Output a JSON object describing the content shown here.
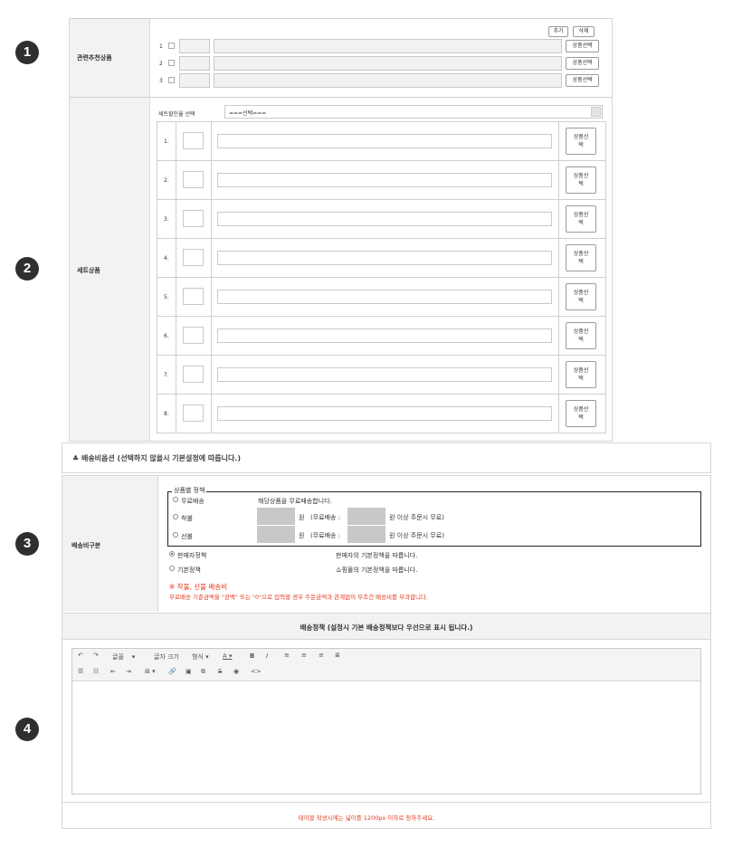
{
  "markers": [
    "1",
    "2",
    "3",
    "4"
  ],
  "related": {
    "label": "관련추천상품",
    "add_label": "추가",
    "delete_label": "삭제",
    "rows": [
      {
        "num": "1",
        "select_label": "상품선택"
      },
      {
        "num": "2",
        "select_label": "상품선택"
      },
      {
        "num": "3",
        "select_label": "상품선택"
      }
    ]
  },
  "set": {
    "label": "세트상품",
    "discount_label": "세트할인율 선택",
    "discount_value": "===선택===",
    "rows": [
      {
        "num": "1.",
        "select_label": "상품선\n택"
      },
      {
        "num": "2.",
        "select_label": "상품선\n택"
      },
      {
        "num": "3.",
        "select_label": "상품선\n택"
      },
      {
        "num": "4.",
        "select_label": "상품선\n택"
      },
      {
        "num": "5.",
        "select_label": "상품선\n택"
      },
      {
        "num": "6.",
        "select_label": "상품선\n택"
      },
      {
        "num": "7.",
        "select_label": "상품선\n택"
      },
      {
        "num": "8.",
        "select_label": "상품선\n택"
      }
    ]
  },
  "shipping": {
    "section_title": "♣ 배송비옵션 (선택하지 않을시 기본설정에 따릅니다.)",
    "label": "배송비구분",
    "legend": "상품별 정책",
    "free_label": "무료배송",
    "free_desc": "해당상품을 무료배송합니다.",
    "cod_label": "착불",
    "prepaid_label": "선불",
    "won": "원",
    "free_threshold_prefix": "(무료배송 :",
    "free_threshold_suffix": "원 이상 주문시 무료)",
    "seller_label": "판매자정책",
    "seller_desc": "판매자의 기본정책을 따릅니다.",
    "default_label": "기본정책",
    "default_desc": "쇼핑몰의 기본정책을 따릅니다.",
    "note_title": "※ 착불, 선불 배송비",
    "note_text": "무료배송 기준금액을 \"공백\" 또는 \"0\"으로 입력할 경우 주문금액과 관계없이 무조건 배송비를 부과합니다."
  },
  "policy": {
    "title": "배송정책 (설정시 기본 배송정책보다 우선으로 표시 됩니다.)",
    "toolbar": {
      "font_label": "글꼴",
      "size_label": "글자 크기",
      "format_label": "형식"
    },
    "footer_note": "테이블 작성시에는 넓이를 1200px 이하로 정하주세요."
  },
  "colors": {
    "accent_red": "#e53b1f",
    "label_bg": "#f2f2f2"
  }
}
